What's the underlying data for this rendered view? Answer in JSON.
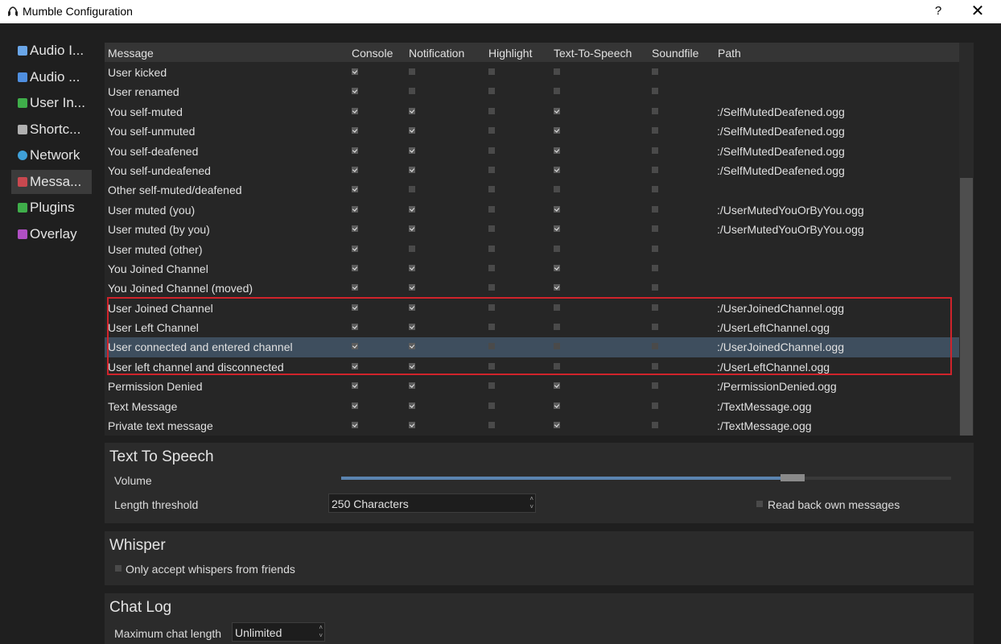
{
  "window": {
    "title": "Mumble Configuration",
    "help": "?",
    "close": "✕"
  },
  "sidebar": {
    "items": [
      {
        "label": "Audio I...",
        "icon": "microphone-icon",
        "color": "#6aa6e8",
        "active": false
      },
      {
        "label": "Audio ...",
        "icon": "speaker-icon",
        "color": "#4f8fe0",
        "active": false
      },
      {
        "label": "User In...",
        "icon": "pin-icon",
        "color": "#3fae4a",
        "active": false
      },
      {
        "label": "Shortc...",
        "icon": "keyboard-icon",
        "color": "#b0b0b0",
        "active": false
      },
      {
        "label": "Network",
        "icon": "globe-icon",
        "color": "#3fa0d8",
        "active": false
      },
      {
        "label": "Messa...",
        "icon": "message-icon",
        "color": "#c9484f",
        "active": true
      },
      {
        "label": "Plugins",
        "icon": "puzzle-icon",
        "color": "#3fae4a",
        "active": false
      },
      {
        "label": "Overlay",
        "icon": "gamepad-icon",
        "color": "#b04fc4",
        "active": false
      }
    ]
  },
  "table": {
    "headers": [
      "Message",
      "Console",
      "Notification",
      "Highlight",
      "Text-To-Speech",
      "Soundfile",
      "Path"
    ],
    "rows": [
      {
        "msg": "User kicked",
        "c": true,
        "n": false,
        "h": false,
        "t": false,
        "s": false,
        "path": ""
      },
      {
        "msg": "User renamed",
        "c": true,
        "n": false,
        "h": false,
        "t": false,
        "s": false,
        "path": ""
      },
      {
        "msg": "You self-muted",
        "c": true,
        "n": true,
        "h": false,
        "t": true,
        "s": false,
        "path": ":/SelfMutedDeafened.ogg"
      },
      {
        "msg": "You self-unmuted",
        "c": true,
        "n": true,
        "h": false,
        "t": true,
        "s": false,
        "path": ":/SelfMutedDeafened.ogg"
      },
      {
        "msg": "You self-deafened",
        "c": true,
        "n": true,
        "h": false,
        "t": true,
        "s": false,
        "path": ":/SelfMutedDeafened.ogg"
      },
      {
        "msg": "You self-undeafened",
        "c": true,
        "n": true,
        "h": false,
        "t": true,
        "s": false,
        "path": ":/SelfMutedDeafened.ogg"
      },
      {
        "msg": "Other self-muted/deafened",
        "c": true,
        "n": false,
        "h": false,
        "t": false,
        "s": false,
        "path": ""
      },
      {
        "msg": "User muted (you)",
        "c": true,
        "n": true,
        "h": false,
        "t": true,
        "s": false,
        "path": ":/UserMutedYouOrByYou.ogg"
      },
      {
        "msg": "User muted (by you)",
        "c": true,
        "n": true,
        "h": false,
        "t": true,
        "s": false,
        "path": ":/UserMutedYouOrByYou.ogg"
      },
      {
        "msg": "User muted (other)",
        "c": true,
        "n": false,
        "h": false,
        "t": false,
        "s": false,
        "path": ""
      },
      {
        "msg": "You Joined Channel",
        "c": true,
        "n": true,
        "h": false,
        "t": true,
        "s": false,
        "path": ""
      },
      {
        "msg": "You Joined Channel (moved)",
        "c": true,
        "n": true,
        "h": false,
        "t": true,
        "s": false,
        "path": ""
      },
      {
        "msg": "User Joined Channel",
        "c": true,
        "n": true,
        "h": false,
        "t": false,
        "s": false,
        "path": ":/UserJoinedChannel.ogg"
      },
      {
        "msg": "User Left Channel",
        "c": true,
        "n": true,
        "h": false,
        "t": false,
        "s": false,
        "path": ":/UserLeftChannel.ogg"
      },
      {
        "msg": "User connected and entered channel",
        "c": true,
        "n": true,
        "h": false,
        "t": false,
        "s": false,
        "path": ":/UserJoinedChannel.ogg",
        "selected": true
      },
      {
        "msg": "User left channel and disconnected",
        "c": true,
        "n": true,
        "h": false,
        "t": false,
        "s": false,
        "path": ":/UserLeftChannel.ogg"
      },
      {
        "msg": "Permission Denied",
        "c": true,
        "n": true,
        "h": false,
        "t": true,
        "s": false,
        "path": ":/PermissionDenied.ogg"
      },
      {
        "msg": "Text Message",
        "c": true,
        "n": true,
        "h": false,
        "t": true,
        "s": false,
        "path": ":/TextMessage.ogg"
      },
      {
        "msg": "Private text message",
        "c": true,
        "n": true,
        "h": false,
        "t": true,
        "s": false,
        "path": ":/TextMessage.ogg"
      }
    ]
  },
  "tts": {
    "title": "Text To Speech",
    "volume_label": "Volume",
    "volume_level": 0.74,
    "length_label": "Length threshold",
    "length_value": "250 Characters",
    "readback_label": "Read back own messages",
    "readback_checked": false
  },
  "whisper": {
    "title": "Whisper",
    "friends_label": "Only accept whispers from friends",
    "friends_checked": false
  },
  "chatlog": {
    "title": "Chat Log",
    "max_label": "Maximum chat length",
    "max_value": "Unlimited"
  }
}
